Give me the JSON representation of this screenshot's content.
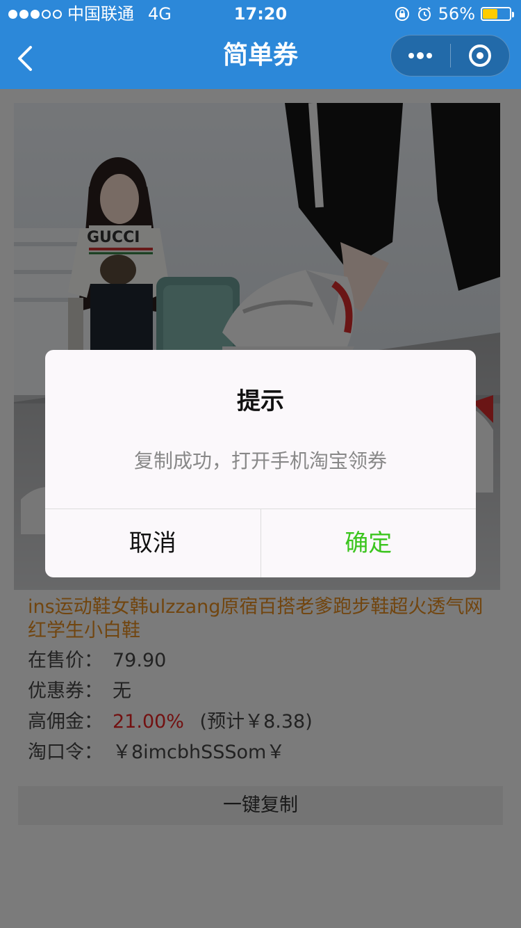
{
  "status_bar": {
    "carrier": "中国联通",
    "network": "4G",
    "time": "17:20",
    "battery_percent": "56%",
    "battery_level": 0.56,
    "signal_filled": 3,
    "signal_total": 5
  },
  "nav": {
    "title": "简单券",
    "back_icon": "chevron-left-icon",
    "more_icon": "more-dots-icon",
    "close_icon": "target-close-icon"
  },
  "product": {
    "title": "ins运动鞋女韩ulzzang原宿百搭老爹跑步鞋超火透气网红学生小白鞋",
    "image_logo_text": "GUCCI",
    "price_label": "在售价：",
    "price": "79.90",
    "coupon_label": "优惠券：",
    "coupon": "无",
    "commission_label": "高佣金：",
    "commission_rate": "21.00%",
    "commission_estimate": "(预计￥8.38)",
    "tkl_label": "淘口令：",
    "tkl": "￥8imcbhSSSom￥",
    "copy_button": "一键复制"
  },
  "modal": {
    "title": "提示",
    "content": "复制成功，打开手机淘宝领券",
    "cancel": "取消",
    "confirm": "确定"
  },
  "colors": {
    "nav_bg": "#2c88d9",
    "title_orange": "#e28a1e",
    "commission_red": "#e52222",
    "confirm_green": "#3cc51f"
  }
}
